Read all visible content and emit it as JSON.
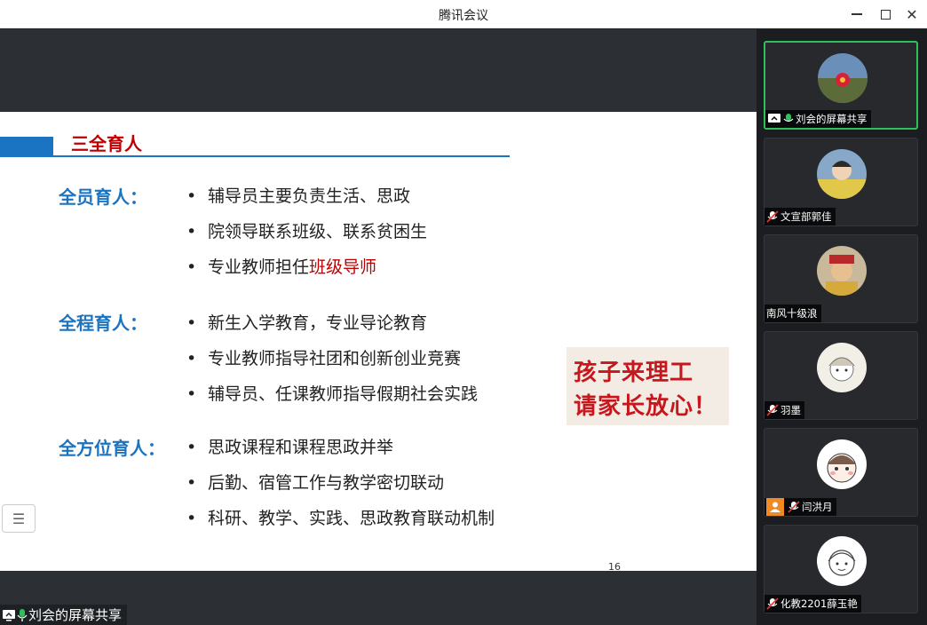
{
  "window": {
    "title": "腾讯会议"
  },
  "slide": {
    "heading": "三全育人",
    "sections": [
      {
        "label": "全员育人：",
        "items": [
          "辅导员主要负责生活、思政",
          "院领导联系班级、联系贫困生",
          "专业教师担任"
        ],
        "highlight": "班级导师"
      },
      {
        "label": "全程育人：",
        "items": [
          "新生入学教育，专业导论教育",
          "专业教师指导社团和创新创业竞赛",
          "辅导员、任课教师指导假期社会实践"
        ]
      },
      {
        "label": "全方位育人：",
        "items": [
          "思政课程和课程思政并举",
          "后勤、宿管工作与教学密切联动",
          "科研、教学、实践、思政教育联动机制"
        ]
      }
    ],
    "stamp": {
      "line1": "孩子来理工",
      "line2": "请家长放心！"
    },
    "page_number": "16",
    "bullet_char": "•"
  },
  "share_label": "刘会的屏幕共享",
  "participants": [
    {
      "name": "刘会的屏幕共享",
      "mic": "on",
      "sharing": true,
      "active": true
    },
    {
      "name": "文宣部郭佳",
      "mic": "muted"
    },
    {
      "name": "南风十级浪",
      "mic": "none"
    },
    {
      "name": "羽墨",
      "mic": "muted"
    },
    {
      "name": "闫洪月",
      "mic": "muted",
      "no_video": true
    },
    {
      "name": "化教2201薛玉艳",
      "mic": "muted"
    }
  ],
  "colors": {
    "accent_blue": "#1b74c1",
    "accent_red": "#c00000",
    "active_border": "#2fbf5b",
    "share_bg": "#2c2f33",
    "panel_bg": "#1b1d20"
  }
}
